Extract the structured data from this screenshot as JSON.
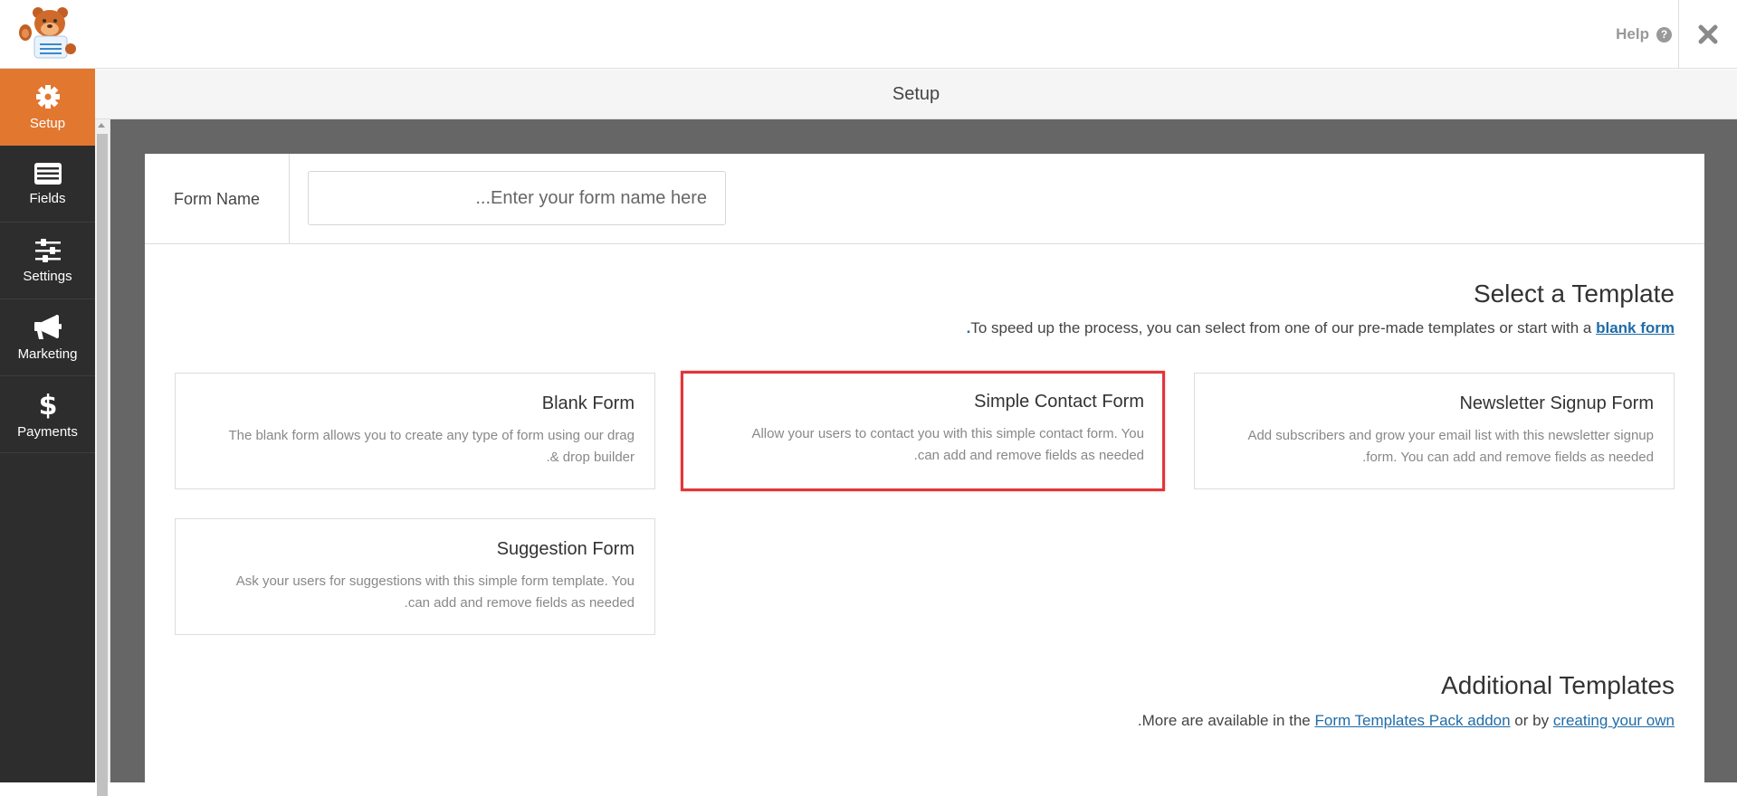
{
  "header": {
    "logo_alt": "WPForms bear mascot",
    "help_label": "Help",
    "help_icon": "question-circle-icon",
    "close_icon": "close-x-icon"
  },
  "sidebar": {
    "items": [
      {
        "label": "Setup",
        "icon": "gear-icon",
        "active": true
      },
      {
        "label": "Fields",
        "icon": "list-icon",
        "active": false
      },
      {
        "label": "Settings",
        "icon": "sliders-icon",
        "active": false
      },
      {
        "label": "Marketing",
        "icon": "megaphone-icon",
        "active": false
      },
      {
        "label": "Payments",
        "icon": "dollar-icon",
        "active": false
      }
    ]
  },
  "subheader": {
    "title": "Setup"
  },
  "form_name": {
    "label": "Form Name",
    "value": "",
    "placeholder": "Enter your form name here..."
  },
  "select_template": {
    "title": "Select a Template",
    "subtitle_text": "To speed up the process, you can select from one of our pre-made templates or start with a ",
    "subtitle_link": "blank form",
    "subtitle_end": "."
  },
  "templates": [
    {
      "name": "Blank Form",
      "description": "The blank form allows you to create any type of form using our drag",
      "description_line2": ".& drop builder",
      "selected": false
    },
    {
      "name": "Simple Contact Form",
      "description": "Allow your users to contact you with this simple contact form. You",
      "description_line2": ".can add and remove fields as needed",
      "selected": true
    },
    {
      "name": "Newsletter Signup Form",
      "description": "Add subscribers and grow your email list with this newsletter signup",
      "description_line2": ".form. You can add and remove fields as needed",
      "selected": false
    },
    {
      "name": "Suggestion Form",
      "description": "Ask your users for suggestions with this simple form template. You",
      "description_line2": ".can add and remove fields as needed",
      "selected": false
    }
  ],
  "additional_templates": {
    "title": "Additional Templates",
    "text_before": ".More are available in the ",
    "link1": "Form Templates Pack addon",
    "text_middle": " or by ",
    "link2": "creating your own"
  },
  "colors": {
    "accent_orange": "#e27730",
    "sidebar_dark": "#2d2d2d",
    "link_blue": "#1f6ca8",
    "selected_border_red": "#e0363a"
  }
}
